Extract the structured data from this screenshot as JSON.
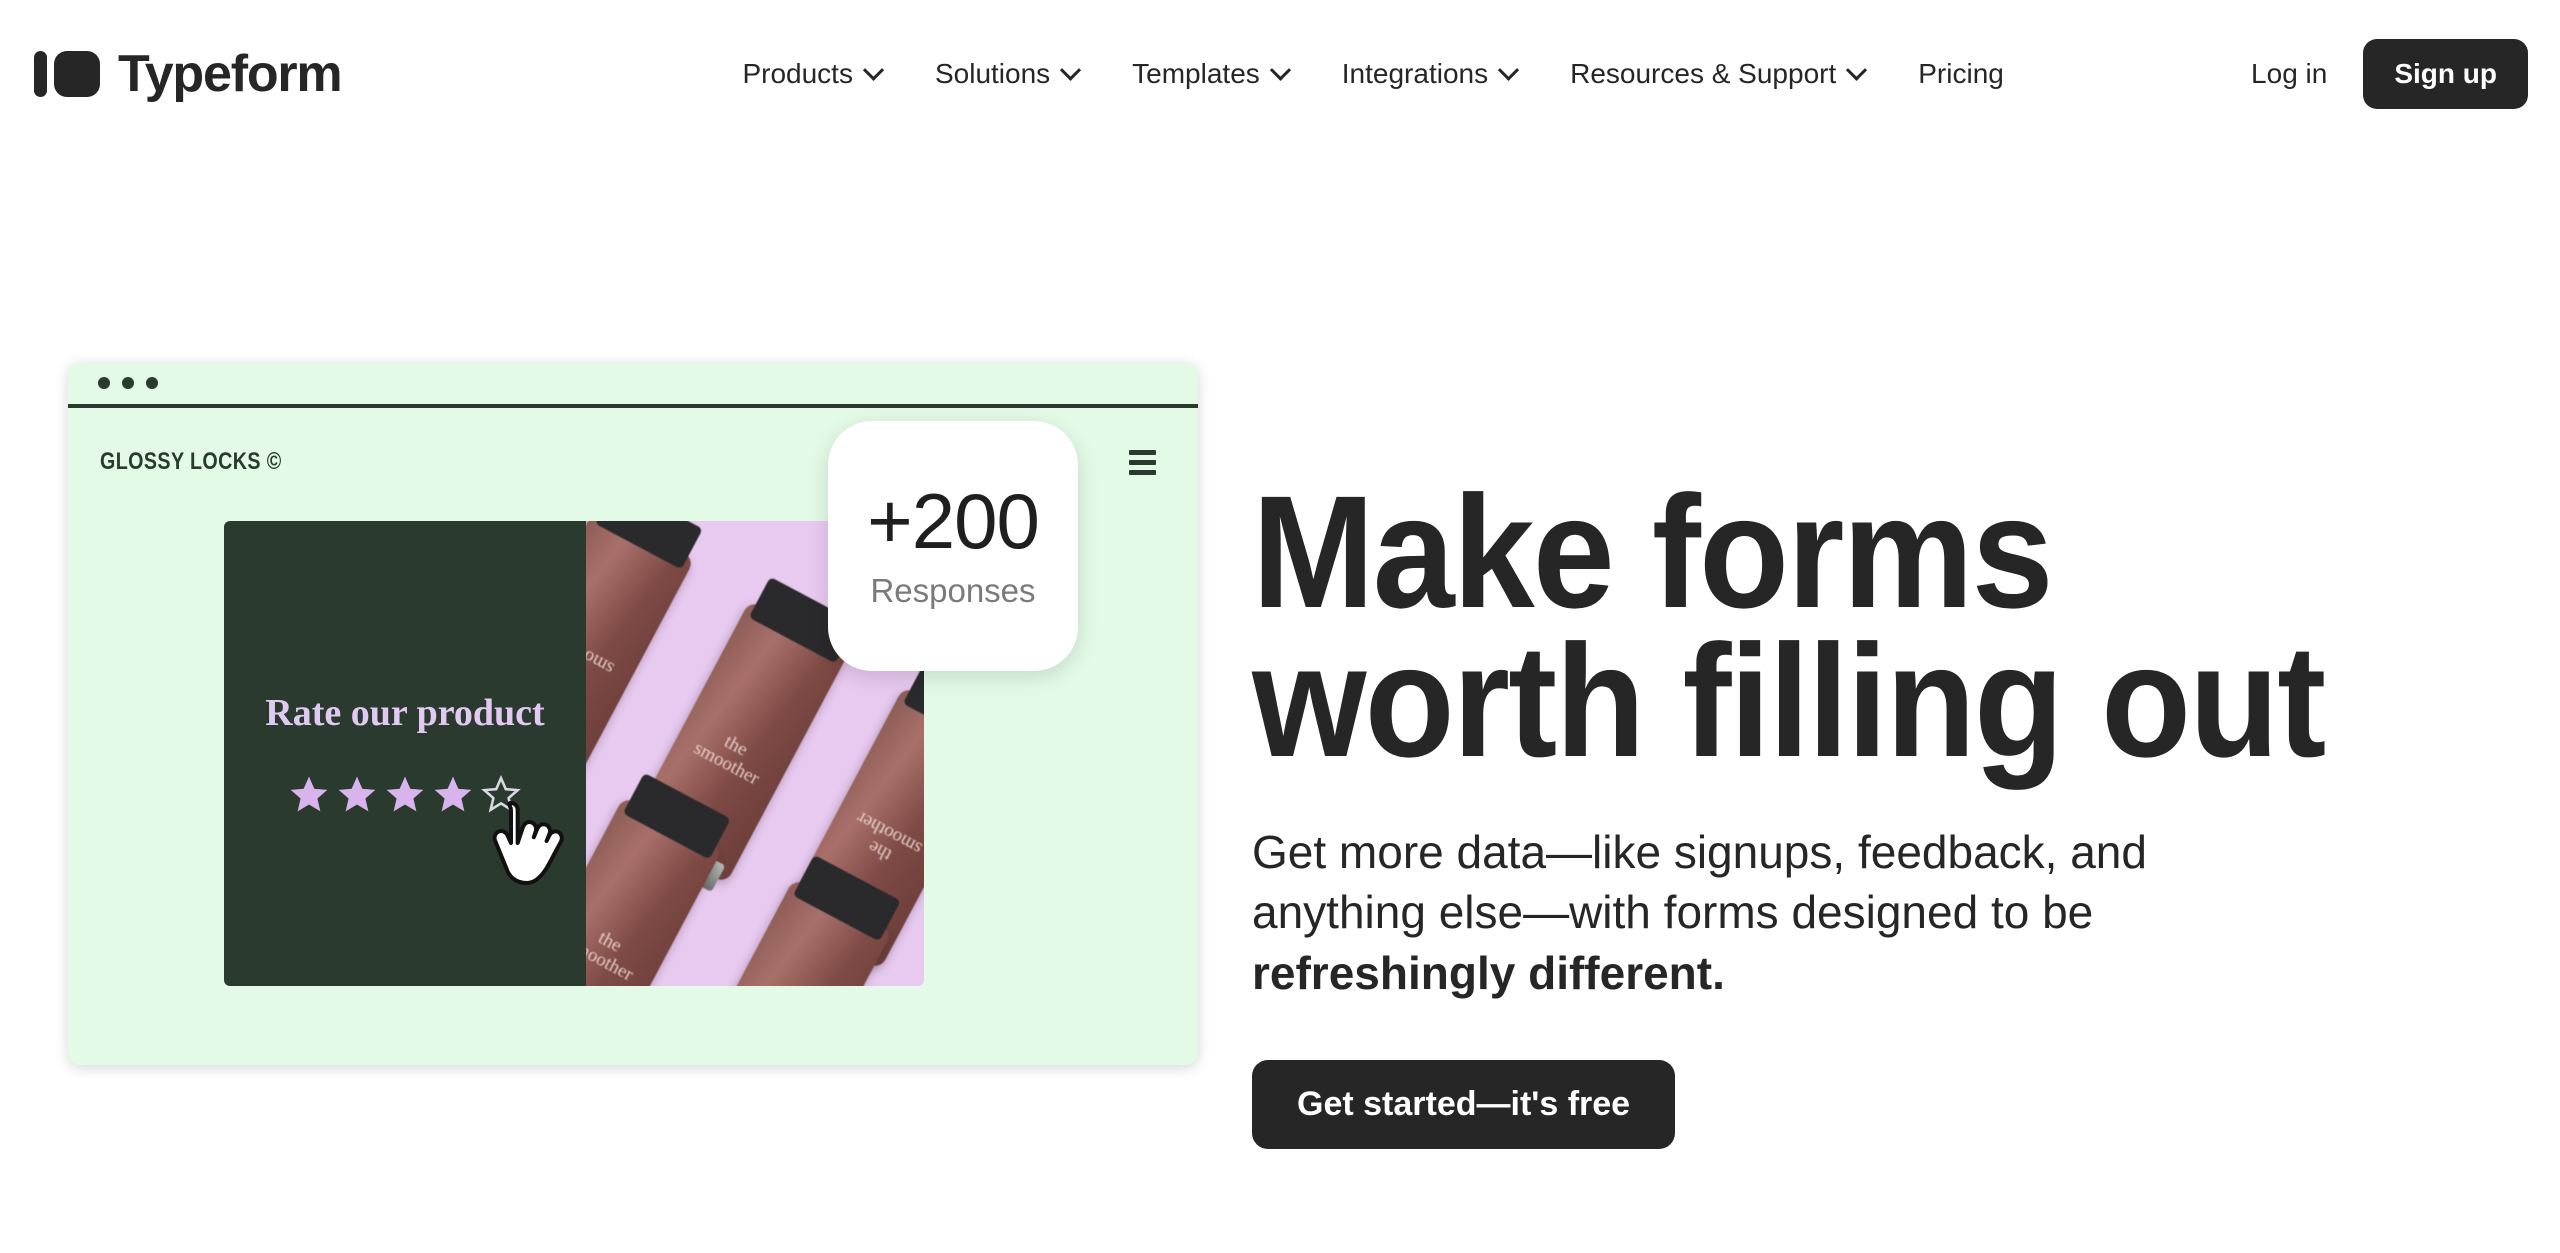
{
  "header": {
    "brand_name": "Typeform",
    "logo_icon": "typeform-logo-icon",
    "nav": [
      {
        "label": "Products",
        "has_dropdown": true,
        "icon": "chevron-down-icon"
      },
      {
        "label": "Solutions",
        "has_dropdown": true,
        "icon": "chevron-down-icon"
      },
      {
        "label": "Templates",
        "has_dropdown": true,
        "icon": "chevron-down-icon"
      },
      {
        "label": "Integrations",
        "has_dropdown": true,
        "icon": "chevron-down-icon"
      },
      {
        "label": "Resources & Support",
        "has_dropdown": true,
        "icon": "chevron-down-icon"
      },
      {
        "label": "Pricing",
        "has_dropdown": false,
        "icon": ""
      }
    ],
    "login_label": "Log in",
    "signup_label": "Sign up"
  },
  "hero": {
    "headline_line1": "Make forms",
    "headline_line2": "worth filling out",
    "subhead_text": "Get more data—like signups, feedback, and anything else—with forms designed to be ",
    "subhead_bold": "refreshingly different.",
    "cta_label": "Get started—it's free"
  },
  "mockup": {
    "window_dots_icon": "window-dots-icon",
    "shop_name": "GLOSSY LOCKS ©",
    "menu_icon": "hamburger-menu-icon",
    "rate_title": "Rate our product",
    "stars_filled": 4,
    "stars_total": 5,
    "cursor_icon": "hand-pointer-icon",
    "bottle_label_line1": "the",
    "bottle_label_line2": "smoother",
    "badge_number": "+200",
    "badge_label": "Responses"
  },
  "colors": {
    "ink": "#262627",
    "mint": "#E3FAE7",
    "dark_green": "#2B3A2E",
    "lavender": "#E8C9F0",
    "star_purple": "#D9B3EC",
    "bottle_brown": "#8B5C55"
  }
}
